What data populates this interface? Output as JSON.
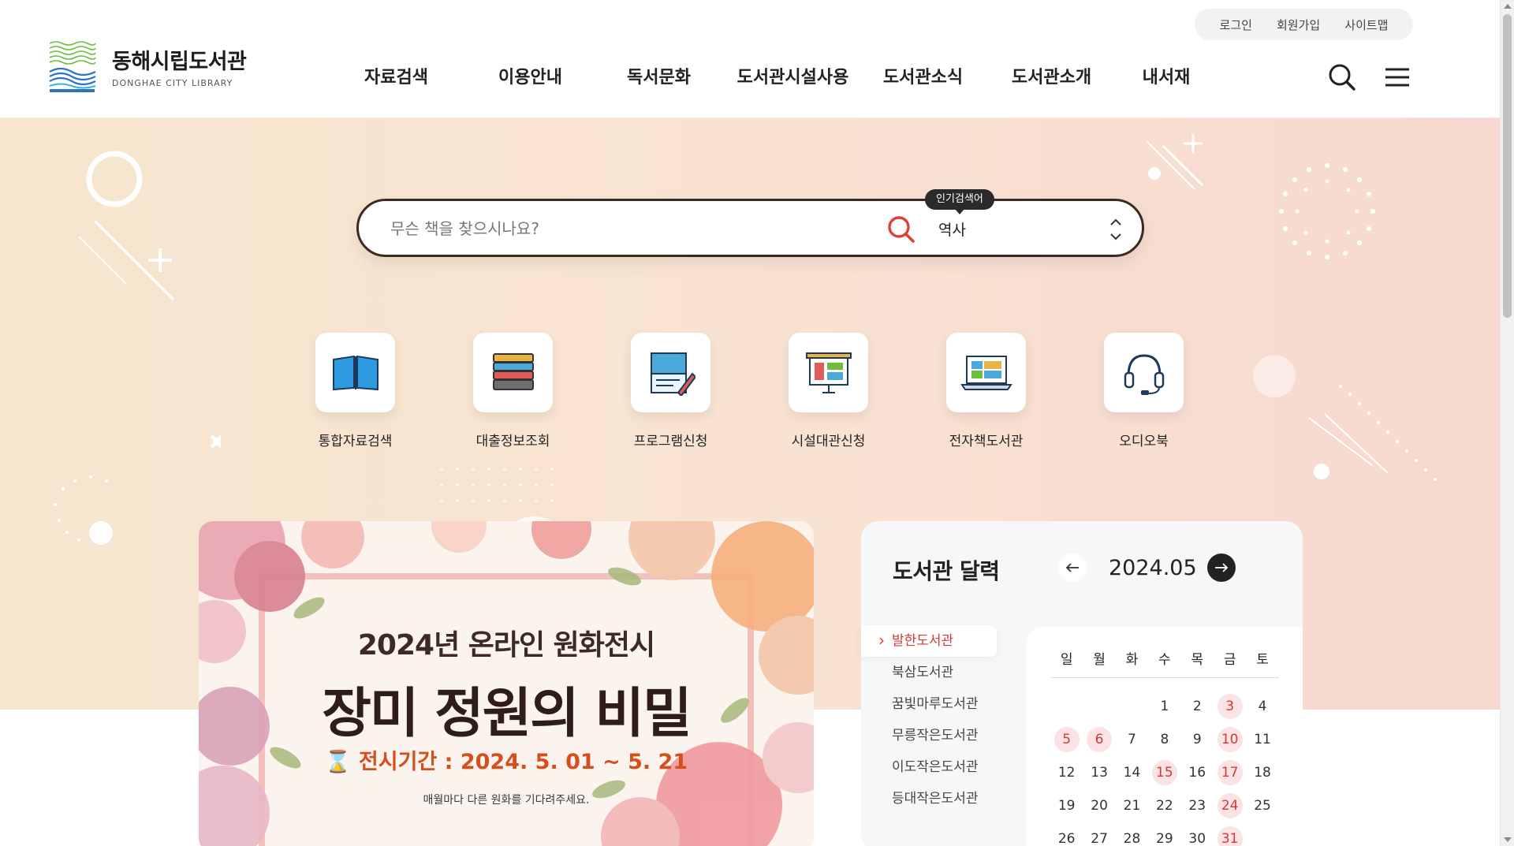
{
  "header": {
    "logo_title": "동해시립도서관",
    "logo_sub": "DONGHAE CITY LIBRARY",
    "util_links": [
      "로그인",
      "회원가입",
      "사이트맵"
    ],
    "nav": [
      "자료검색",
      "이용안내",
      "독서문화",
      "도서관시설사용",
      "도서관소식",
      "도서관소개",
      "내서재"
    ]
  },
  "search": {
    "placeholder": "무슨 책을 찾으시나요?",
    "popular_label": "인기검색어",
    "popular_value": "역사"
  },
  "quick_links": [
    {
      "label": "통합자료검색",
      "icon": "open-book-icon"
    },
    {
      "label": "대출정보조회",
      "icon": "book-stack-icon"
    },
    {
      "label": "프로그램신청",
      "icon": "document-pen-icon"
    },
    {
      "label": "시설대관신청",
      "icon": "presentation-board-icon"
    },
    {
      "label": "전자책도서관",
      "icon": "laptop-icon"
    },
    {
      "label": "오디오북",
      "icon": "headset-icon"
    }
  ],
  "banner": {
    "line1": "2024년 온라인 원화전시",
    "line2": "장미 정원의 비밀",
    "line3": "전시기간 : 2024. 5. 01 ~ 5. 21",
    "line4": "매월마다 다른 원화를 기다려주세요."
  },
  "calendar": {
    "title": "도서관 달력",
    "month": "2024.05",
    "libraries": [
      "발한도서관",
      "북삼도서관",
      "꿈빛마루도서관",
      "무릉작은도서관",
      "이도작은도서관",
      "등대작은도서관"
    ],
    "weekdays": [
      "일",
      "월",
      "화",
      "수",
      "목",
      "금",
      "토"
    ],
    "weeks": [
      [
        "",
        "",
        "",
        "1",
        "2",
        "3",
        "4"
      ],
      [
        "5",
        "6",
        "7",
        "8",
        "9",
        "10",
        "11"
      ],
      [
        "12",
        "13",
        "14",
        "15",
        "16",
        "17",
        "18"
      ],
      [
        "19",
        "20",
        "21",
        "22",
        "23",
        "24",
        "25"
      ],
      [
        "26",
        "27",
        "28",
        "29",
        "30",
        "31",
        ""
      ]
    ],
    "closed_days": [
      "3",
      "5",
      "6",
      "10",
      "15",
      "17",
      "24",
      "31"
    ]
  },
  "colors": {
    "accent": "#d23b3b",
    "event_bg": "#fbe2e4",
    "search_border": "#3a2a22"
  }
}
